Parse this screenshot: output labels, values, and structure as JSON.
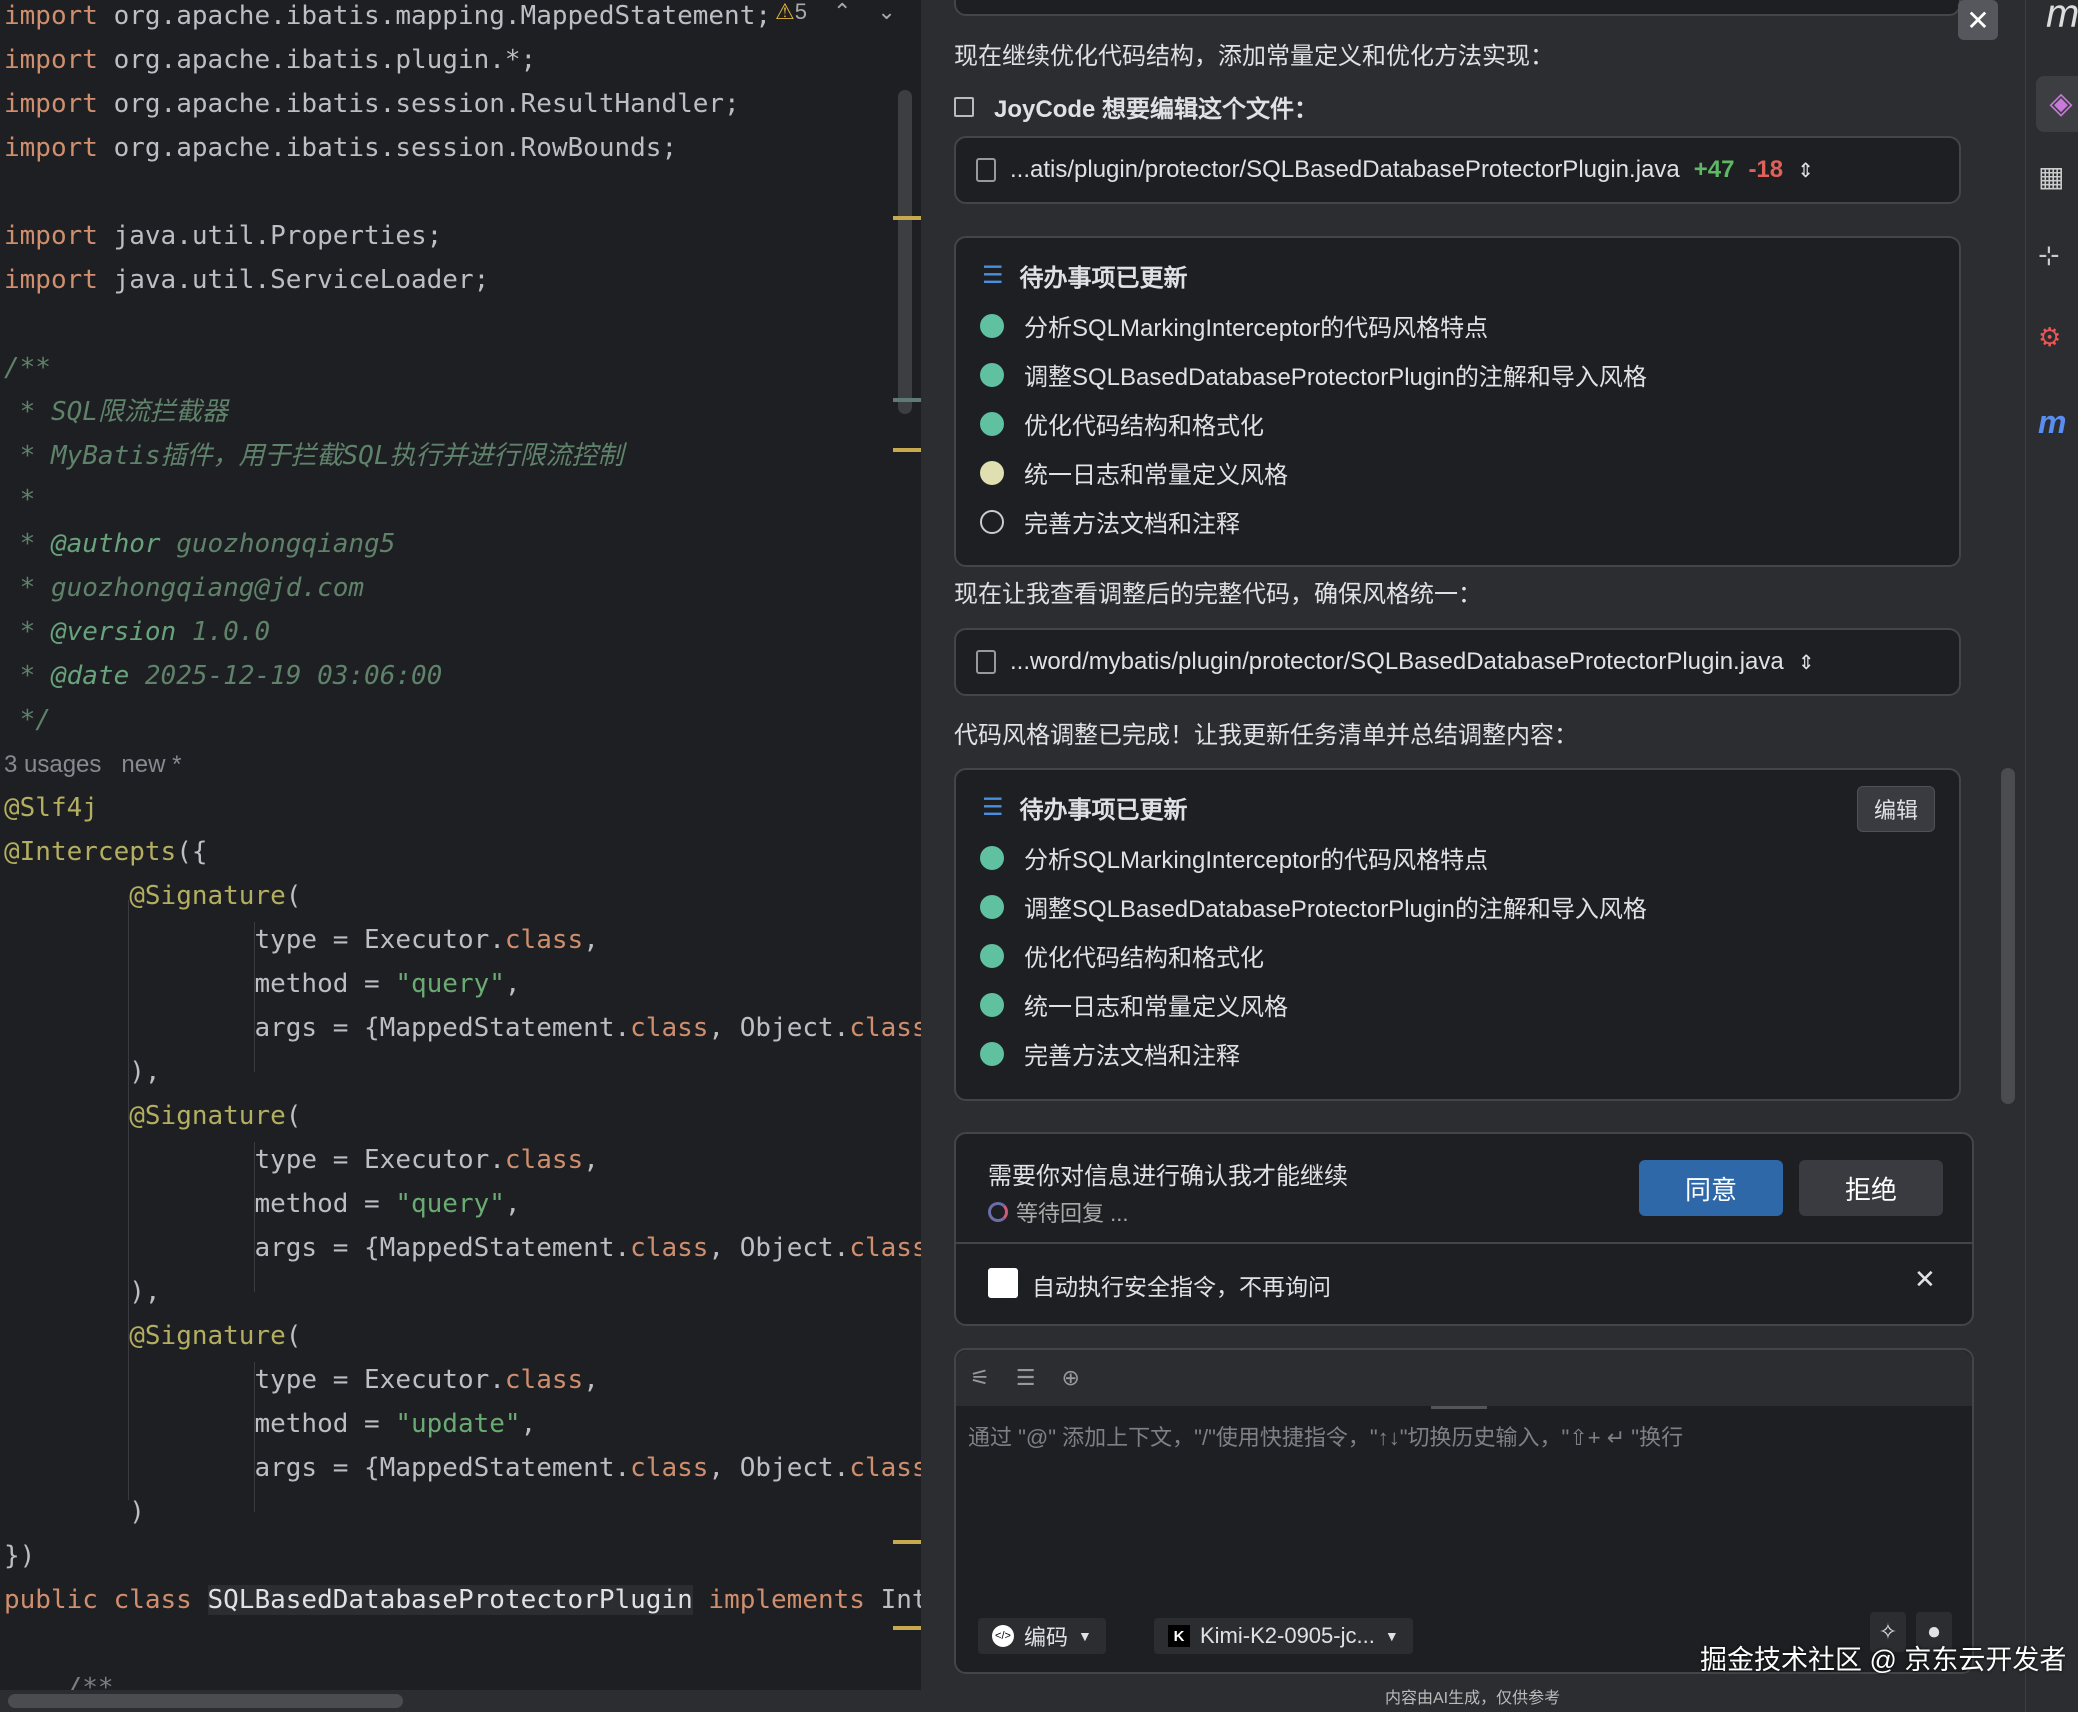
{
  "editor": {
    "warning_count": "5",
    "lines": [
      [
        [
          "kw",
          "import"
        ],
        [
          "pl",
          " org.apache.ibatis.mapping.MappedStatement;"
        ]
      ],
      [
        [
          "kw",
          "import"
        ],
        [
          "pl",
          " org.apache.ibatis.plugin.*;"
        ]
      ],
      [
        [
          "kw",
          "import"
        ],
        [
          "pl",
          " org.apache.ibatis.session.ResultHandler;"
        ]
      ],
      [
        [
          "kw",
          "import"
        ],
        [
          "pl",
          " org.apache.ibatis.session.RowBounds;"
        ]
      ],
      [],
      [
        [
          "kw",
          "import"
        ],
        [
          "pl",
          " java.util.Properties;"
        ]
      ],
      [
        [
          "kw",
          "import"
        ],
        [
          "pl",
          " java.util.ServiceLoader;"
        ]
      ],
      [],
      [
        [
          "doc",
          "/**"
        ]
      ],
      [
        [
          "doc",
          " * SQL限流拦截器"
        ]
      ],
      [
        [
          "doc",
          " * MyBatis插件，用于拦截SQL执行并进行限流控制"
        ]
      ],
      [
        [
          "doc",
          " *"
        ]
      ],
      [
        [
          "doc",
          " * "
        ],
        [
          "tag",
          "@author"
        ],
        [
          "doc",
          " guozhongqiang5"
        ]
      ],
      [
        [
          "doc",
          " * guozhongqiang@jd.com"
        ]
      ],
      [
        [
          "doc",
          " * "
        ],
        [
          "tag",
          "@version"
        ],
        [
          "doc",
          " 1.0.0"
        ]
      ],
      [
        [
          "doc",
          " * "
        ],
        [
          "tag",
          "@date"
        ],
        [
          "doc",
          " 2025-12-19 03:06:00"
        ]
      ],
      [
        [
          "doc",
          " */"
        ]
      ],
      [
        [
          "hint",
          "3 usages   new *"
        ]
      ],
      [
        [
          "an",
          "@Slf4j"
        ]
      ],
      [
        [
          "an",
          "@Intercepts"
        ],
        [
          "pl",
          "({"
        ]
      ],
      [
        [
          "pl",
          "        "
        ],
        [
          "an",
          "@Signature"
        ],
        [
          "pl",
          "("
        ]
      ],
      [
        [
          "pl",
          "                type = Executor."
        ],
        [
          "kw",
          "class"
        ],
        [
          "pl",
          ","
        ]
      ],
      [
        [
          "pl",
          "                method = "
        ],
        [
          "str",
          "\"query\""
        ],
        [
          "pl",
          ","
        ]
      ],
      [
        [
          "pl",
          "                args = {MappedStatement."
        ],
        [
          "kw",
          "class"
        ],
        [
          "pl",
          ", Object."
        ],
        [
          "kw",
          "class"
        ]
      ],
      [
        [
          "pl",
          "        ),"
        ]
      ],
      [
        [
          "pl",
          "        "
        ],
        [
          "an",
          "@Signature"
        ],
        [
          "pl",
          "("
        ]
      ],
      [
        [
          "pl",
          "                type = Executor."
        ],
        [
          "kw",
          "class"
        ],
        [
          "pl",
          ","
        ]
      ],
      [
        [
          "pl",
          "                method = "
        ],
        [
          "str",
          "\"query\""
        ],
        [
          "pl",
          ","
        ]
      ],
      [
        [
          "pl",
          "                args = {MappedStatement."
        ],
        [
          "kw",
          "class"
        ],
        [
          "pl",
          ", Object."
        ],
        [
          "kw",
          "class"
        ]
      ],
      [
        [
          "pl",
          "        ),"
        ]
      ],
      [
        [
          "pl",
          "        "
        ],
        [
          "an",
          "@Signature"
        ],
        [
          "pl",
          "("
        ]
      ],
      [
        [
          "pl",
          "                type = Executor."
        ],
        [
          "kw",
          "class"
        ],
        [
          "pl",
          ","
        ]
      ],
      [
        [
          "pl",
          "                method = "
        ],
        [
          "str",
          "\"update\""
        ],
        [
          "pl",
          ","
        ]
      ],
      [
        [
          "pl",
          "                args = {MappedStatement."
        ],
        [
          "kw",
          "class"
        ],
        [
          "pl",
          ", Object."
        ],
        [
          "kw",
          "class"
        ]
      ],
      [
        [
          "pl",
          "        )"
        ]
      ],
      [
        [
          "pl",
          "})"
        ]
      ],
      [
        [
          "kw",
          "public class "
        ],
        [
          "cls",
          "SQLBasedDatabaseProtectorPlugin"
        ],
        [
          "kw",
          " implements "
        ],
        [
          "pl",
          "Int"
        ]
      ],
      [],
      [
        [
          "cm",
          "    /**"
        ]
      ]
    ]
  },
  "chat": {
    "msg1": "现在继续优化代码结构，添加常量定义和优化方法实现：",
    "edit_header": "JoyCode 想要编辑这个文件：",
    "file1": {
      "path": "...atis/plugin/protector/SQLBasedDatabaseProtectorPlugin.java",
      "added": "+47",
      "removed": "-18"
    },
    "todo1": {
      "title": "待办事项已更新",
      "items": [
        {
          "label": "分析SQLMarkingInterceptor的代码风格特点",
          "status": "done"
        },
        {
          "label": "调整SQLBasedDatabaseProtectorPlugin的注解和导入风格",
          "status": "done"
        },
        {
          "label": "优化代码结构和格式化",
          "status": "done"
        },
        {
          "label": "统一日志和常量定义风格",
          "status": "in-progress"
        },
        {
          "label": "完善方法文档和注释",
          "status": "pending"
        }
      ]
    },
    "msg2": "现在让我查看调整后的完整代码，确保风格统一：",
    "file2": {
      "path": "...word/mybatis/plugin/protector/SQLBasedDatabaseProtectorPlugin.java"
    },
    "msg3": "代码风格调整已完成！让我更新任务清单并总结调整内容：",
    "todo2": {
      "title": "待办事项已更新",
      "edit_label": "编辑",
      "items": [
        {
          "label": "分析SQLMarkingInterceptor的代码风格特点",
          "status": "done"
        },
        {
          "label": "调整SQLBasedDatabaseProtectorPlugin的注解和导入风格",
          "status": "done"
        },
        {
          "label": "优化代码结构和格式化",
          "status": "done"
        },
        {
          "label": "统一日志和常量定义风格",
          "status": "done"
        },
        {
          "label": "完善方法文档和注释",
          "status": "done"
        }
      ]
    },
    "confirm": {
      "text": "需要你对信息进行确认我才能继续",
      "waiting": "等待回复 ...",
      "agree": "同意",
      "reject": "拒绝",
      "auto_label": "自动执行安全指令，不再询问"
    },
    "input": {
      "placeholder": "通过 \"@\" 添加上下文，\"/\"使用快捷指令，\"↑↓\"切换历史输入，\"⇧+ ↵ \"换行",
      "mode": "编码",
      "model": "Kimi-K2-0905-jc..."
    },
    "footer": "内容由AI生成，仅供参考",
    "watermark": "掘金技术社区 @ 京东云开发者"
  },
  "colors": {
    "done": "#5fc1a0",
    "in_progress": "#e0dfb1",
    "accent": "#2e68a8",
    "added": "#5fb865",
    "removed": "#e0605a"
  }
}
